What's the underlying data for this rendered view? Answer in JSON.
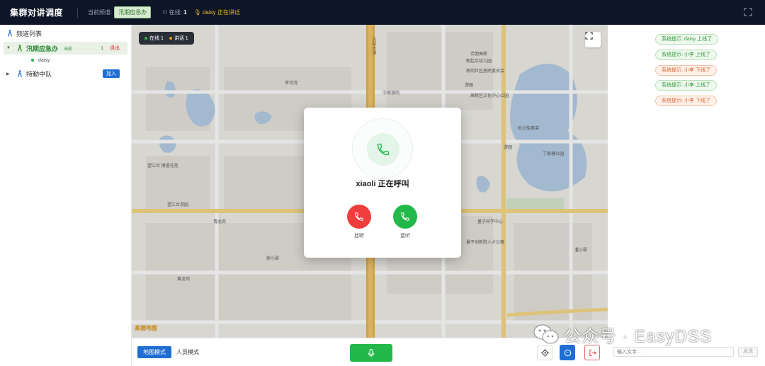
{
  "topbar": {
    "title": "集群对讲调度",
    "current_channel_label": "当前频道:",
    "current_channel": "汛期应急办",
    "online_label": "在线:",
    "online_count": "1",
    "speaking": "daisy 正在讲话"
  },
  "sidebar": {
    "header": "频道列表",
    "channels": [
      {
        "name": "汛期应急办",
        "current_tag": "当前",
        "count": "1",
        "action": "退出",
        "expanded": true,
        "members": [
          "daisy"
        ]
      },
      {
        "name": "特勤中队",
        "action": "加入",
        "expanded": false
      }
    ]
  },
  "map": {
    "status_online": "在线 1",
    "status_speaking": "讲话 1",
    "labels": [
      "万科大道",
      "合肥高新",
      "新起点幼儿园",
      "南岗社区居民委员会",
      "游园",
      "李河湾",
      "中南银岗",
      "高新区文化中心公园",
      "砂之船奥莱",
      "游园",
      "丁家塘公园",
      "望江台 擦搓花苑",
      "望江台游园",
      "青龙岗",
      "量子科学中心",
      "量子创新院人才公寓",
      "潘小郢",
      "郝小郢",
      "黄龙岗"
    ],
    "amap_logo": "高德地图"
  },
  "modal": {
    "caller_text": "xiaoli 正在呼叫",
    "hangup_label": "挂断",
    "answer_label": "接听"
  },
  "bottombar": {
    "map_mode": "地图模式",
    "people_mode": "人员模式"
  },
  "rightpanel": {
    "notifications": [
      {
        "text": "系统提示: daisy 上线了",
        "type": "online"
      },
      {
        "text": "系统提示: 小李 上线了",
        "type": "online"
      },
      {
        "text": "系统提示: 小李 下线了",
        "type": "offline"
      },
      {
        "text": "系统提示: 小李 上线了",
        "type": "online"
      },
      {
        "text": "系统提示: 小李 下线了",
        "type": "offline"
      }
    ],
    "input_placeholder": "输入文字...",
    "send_label": "发送"
  },
  "watermark": {
    "text": "公众号 · EasyDSS"
  },
  "colors": {
    "topbar_bg": "#0d1526",
    "accent_blue": "#1f6ed4",
    "green": "#22b94a",
    "red": "#ef3d3d"
  }
}
